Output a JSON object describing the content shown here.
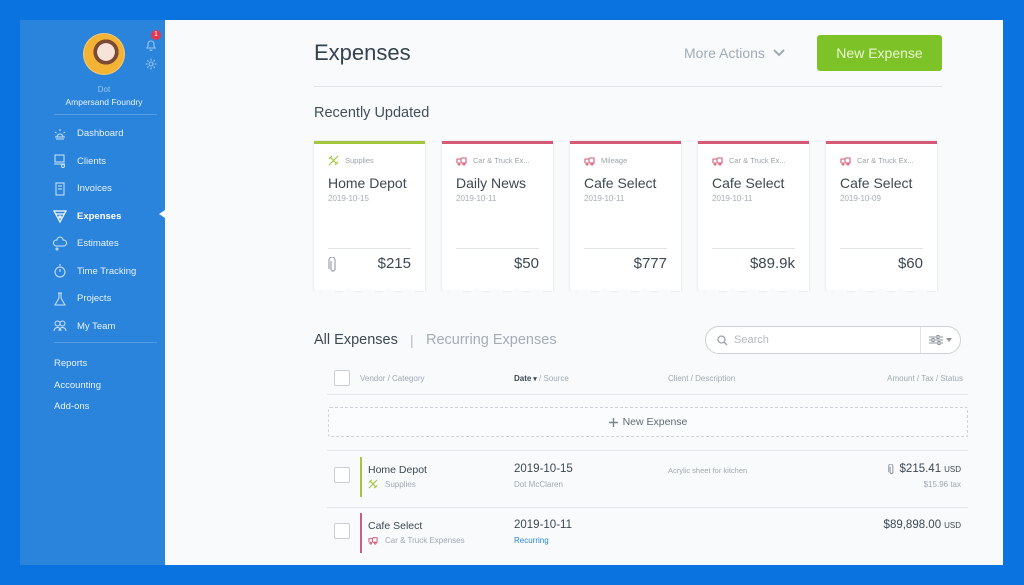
{
  "user": {
    "name": "Dot",
    "organization": "Ampersand Foundry",
    "notifications_count": "1"
  },
  "sidebar": {
    "items": [
      {
        "label": "Dashboard",
        "icon": "dashboard-icon",
        "active": false
      },
      {
        "label": "Clients",
        "icon": "clients-icon",
        "active": false
      },
      {
        "label": "Invoices",
        "icon": "invoices-icon",
        "active": false
      },
      {
        "label": "Expenses",
        "icon": "expenses-icon",
        "active": true
      },
      {
        "label": "Estimates",
        "icon": "estimates-icon",
        "active": false
      },
      {
        "label": "Time Tracking",
        "icon": "stopwatch-icon",
        "active": false
      },
      {
        "label": "Projects",
        "icon": "flask-icon",
        "active": false
      },
      {
        "label": "My Team",
        "icon": "team-icon",
        "active": false
      }
    ],
    "secondary": [
      "Reports",
      "Accounting",
      "Add-ons"
    ]
  },
  "header": {
    "title": "Expenses",
    "more_actions_label": "More Actions",
    "new_expense_label": "New Expense"
  },
  "recent": {
    "title": "Recently Updated",
    "cards": [
      {
        "category": "Supplies",
        "vendor": "Home Depot",
        "date": "2019-10-15",
        "amount": "$215",
        "has_attachment": true,
        "accent": "#a3c63c"
      },
      {
        "category": "Car & Truck Ex...",
        "vendor": "Daily News",
        "date": "2019-10-11",
        "amount": "$50",
        "has_attachment": false,
        "accent": "#d45a78"
      },
      {
        "category": "Mileage",
        "vendor": "Cafe Select",
        "date": "2019-10-11",
        "amount": "$777",
        "has_attachment": false,
        "accent": "#d45a78"
      },
      {
        "category": "Car & Truck Ex...",
        "vendor": "Cafe Select",
        "date": "2019-10-11",
        "amount": "$89.9k",
        "has_attachment": false,
        "accent": "#d45a78"
      },
      {
        "category": "Car & Truck Ex...",
        "vendor": "Cafe Select",
        "date": "2019-10-09",
        "amount": "$60",
        "has_attachment": false,
        "accent": "#d45a78"
      }
    ]
  },
  "tabs": {
    "all": "All Expenses",
    "separator": "|",
    "recurring": "Recurring Expenses"
  },
  "search": {
    "placeholder": "Search",
    "value": ""
  },
  "table": {
    "columns": {
      "vendor": "Vendor / Category",
      "date": "Date",
      "source": " / Source",
      "client": "Client / Description",
      "amount": "Amount / Tax / Status"
    },
    "new_row_label": "New Expense",
    "rows": [
      {
        "vendor": "Home Depot",
        "category": "Supplies",
        "date": "2019-10-15",
        "source": "Dot McClaren",
        "description": "Acrylic sheet for kitchen",
        "amount": "$215.41",
        "currency": "USD",
        "tax": "$15.96 tax",
        "has_attachment": true,
        "accent": "#a3c63c"
      },
      {
        "vendor": "Cafe Select",
        "category": "Car & Truck Expenses",
        "date": "2019-10-11",
        "source": "Recurring",
        "description": "",
        "amount": "$89,898.00",
        "currency": "USD",
        "tax": "",
        "has_attachment": false,
        "accent": "#c8607a"
      }
    ]
  },
  "colors": {
    "brand_blue": "#2b84db",
    "outer_blue": "#0a73e0",
    "primary_green": "#7dc226",
    "supplies_green": "#a3c63c",
    "vehicle_pink": "#d45a78"
  }
}
